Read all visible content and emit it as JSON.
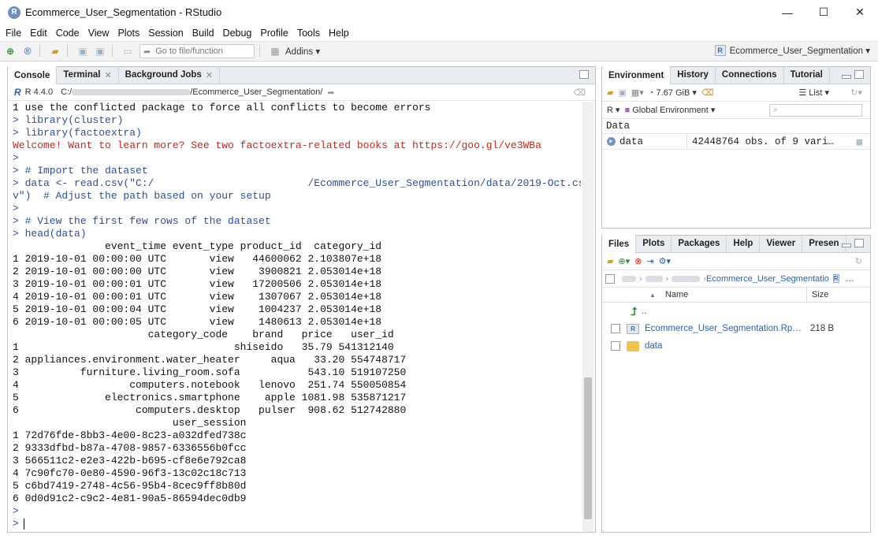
{
  "window": {
    "title": "Ecommerce_User_Segmentation - RStudio",
    "logo_letter": "R",
    "minimize": "—",
    "maximize": "☐",
    "close": "✕"
  },
  "menu": [
    "File",
    "Edit",
    "Code",
    "View",
    "Plots",
    "Session",
    "Build",
    "Debug",
    "Profile",
    "Tools",
    "Help"
  ],
  "toolbar": {
    "goto_placeholder": "Go to file/function",
    "addins_label": "Addins ▾",
    "project_label": "Ecommerce_User_Segmentation ▾"
  },
  "console": {
    "tabs": [
      {
        "label": "Console",
        "closable": false
      },
      {
        "label": "Terminal",
        "closable": true
      },
      {
        "label": "Background Jobs",
        "closable": true
      }
    ],
    "r_version": "R 4.4.0",
    "path_prefix": "C:/",
    "path_suffix": "/Ecommerce_User_Segmentation/",
    "lines": [
      {
        "type": "out",
        "text": "1 use the conflicted package to force all conflicts to become errors"
      },
      {
        "type": "cmd",
        "text": "> library(cluster)"
      },
      {
        "type": "cmd",
        "text": "> library(factoextra)"
      },
      {
        "type": "err",
        "text": "Welcome! Want to learn more? See two factoextra-related books at https://goo.gl/ve3WBa"
      },
      {
        "type": "cmd",
        "text": ">"
      },
      {
        "type": "cmd",
        "text": "> # Import the dataset"
      },
      {
        "type": "cmd",
        "text": "> data <- read.csv(\"C:/                         /Ecommerce_User_Segmentation/data/2019-Oct.cs"
      },
      {
        "type": "cmd",
        "text": "v\")  # Adjust the path based on your setup"
      },
      {
        "type": "cmd",
        "text": ">"
      },
      {
        "type": "cmd",
        "text": "> # View the first few rows of the dataset"
      },
      {
        "type": "cmd",
        "text": "> head(data)"
      },
      {
        "type": "out",
        "text": "               event_time event_type product_id  category_id"
      },
      {
        "type": "out",
        "text": "1 2019-10-01 00:00:00 UTC       view   44600062 2.103807e+18"
      },
      {
        "type": "out",
        "text": "2 2019-10-01 00:00:00 UTC       view    3900821 2.053014e+18"
      },
      {
        "type": "out",
        "text": "3 2019-10-01 00:00:01 UTC       view   17200506 2.053014e+18"
      },
      {
        "type": "out",
        "text": "4 2019-10-01 00:00:01 UTC       view    1307067 2.053014e+18"
      },
      {
        "type": "out",
        "text": "5 2019-10-01 00:00:04 UTC       view    1004237 2.053014e+18"
      },
      {
        "type": "out",
        "text": "6 2019-10-01 00:00:05 UTC       view    1480613 2.053014e+18"
      },
      {
        "type": "out",
        "text": "                      category_code    brand   price   user_id"
      },
      {
        "type": "out",
        "text": "1                                   shiseido   35.79 541312140"
      },
      {
        "type": "out",
        "text": "2 appliances.environment.water_heater     aqua   33.20 554748717"
      },
      {
        "type": "out",
        "text": "3          furniture.living_room.sofa           543.10 519107250"
      },
      {
        "type": "out",
        "text": "4                  computers.notebook   lenovo  251.74 550050854"
      },
      {
        "type": "out",
        "text": "5              electronics.smartphone    apple 1081.98 535871217"
      },
      {
        "type": "out",
        "text": "6                   computers.desktop   pulser  908.62 512742880"
      },
      {
        "type": "out",
        "text": "                          user_session"
      },
      {
        "type": "out",
        "text": "1 72d76fde-8bb3-4e00-8c23-a032dfed738c"
      },
      {
        "type": "out",
        "text": "2 9333dfbd-b87a-4708-9857-6336556b0fcc"
      },
      {
        "type": "out",
        "text": "3 566511c2-e2e3-422b-b695-cf8e6e792ca8"
      },
      {
        "type": "out",
        "text": "4 7c90fc70-0e80-4590-96f3-13c02c18c713"
      },
      {
        "type": "out",
        "text": "5 c6bd7419-2748-4c56-95b4-8cec9ff8b80d"
      },
      {
        "type": "out",
        "text": "6 0d0d91c2-c9c2-4e81-90a5-86594dec0db9"
      },
      {
        "type": "cmd",
        "text": ">"
      },
      {
        "type": "prompt",
        "text": ">"
      }
    ]
  },
  "environment": {
    "tabs": [
      "Environment",
      "History",
      "Connections",
      "Tutorial"
    ],
    "memory": "7.67 GiB",
    "list_label": "List",
    "r_label": "R",
    "scope": "Global Environment",
    "section_header": "Data",
    "rows": [
      {
        "name": "data",
        "value": "42448764 obs. of 9 vari…"
      }
    ]
  },
  "files": {
    "tabs": [
      "Files",
      "Plots",
      "Packages",
      "Help",
      "Viewer",
      "Presen"
    ],
    "breadcrumb_current": "Ecommerce_User_Segmentatio",
    "header_name": "Name",
    "header_size": "Size",
    "up_label": "..",
    "items": [
      {
        "name": "Ecommerce_User_Segmentation.Rp…",
        "size": "218 B",
        "kind": "rproj"
      },
      {
        "name": "data",
        "size": "",
        "kind": "folder"
      }
    ]
  }
}
